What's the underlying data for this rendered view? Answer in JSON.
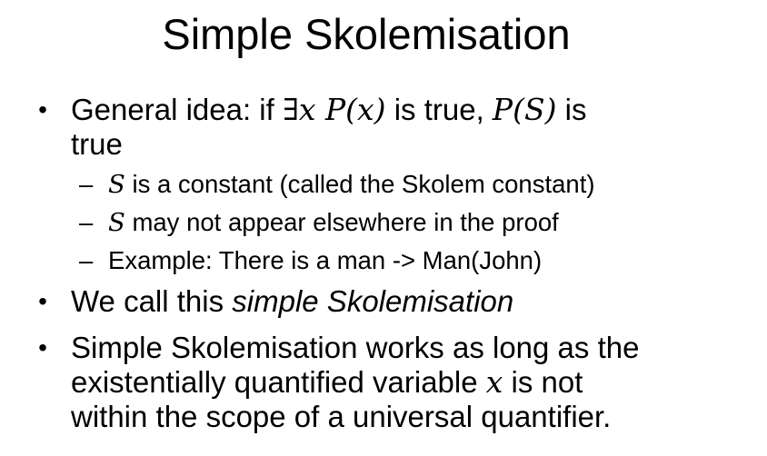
{
  "slide": {
    "title": "Simple Skolemisation",
    "bullet_glyph": "•",
    "dash_glyph": "–",
    "bullets": [
      {
        "pre": "General idea: if ",
        "math1": "∃x P(x)",
        "mid": " is true, ",
        "math2": "P(S)",
        "post": " is",
        "line2": "true"
      },
      {
        "pre": "We call this ",
        "emph": "simple Skolemisation"
      },
      {
        "line1": "Simple Skolemisation works as long as the",
        "line2_pre": "existentially quantified variable ",
        "line2_math": "x",
        "line2_post": " is not",
        "line3": "within the scope of a universal quantifier."
      }
    ],
    "subbullets": [
      {
        "math": "S",
        "text": " is a constant (called the Skolem constant)"
      },
      {
        "math": "S",
        "text": " may not appear elsewhere in the proof"
      },
      {
        "text": "Example: There is a man ->  Man(John)"
      }
    ]
  }
}
